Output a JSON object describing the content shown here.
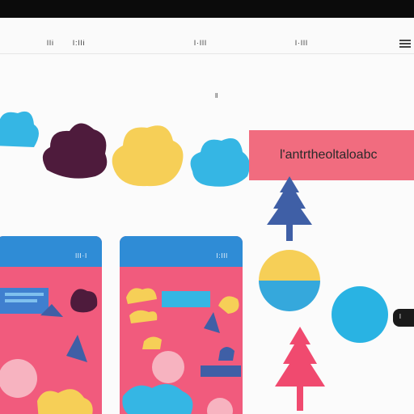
{
  "topbar": {
    "item_left_1": "lli",
    "item_left_2": "l:lli",
    "item_center": "l·lll",
    "item_right": "l·lll",
    "menu_icon": "menu-icon"
  },
  "subtitle": "ll",
  "banner": {
    "text": "l'antrtheoltaloabc"
  },
  "cards": [
    {
      "header_label": "lll·l"
    },
    {
      "header_label": "l:lll"
    }
  ],
  "pill": {
    "label": "l"
  },
  "colors": {
    "pink": "#f16c7f",
    "blue": "#35b6e4",
    "yellow": "#f6cf57",
    "plum": "#4e1b3c",
    "navy": "#3f5fa6",
    "header_blue": "#2f8cd6"
  }
}
